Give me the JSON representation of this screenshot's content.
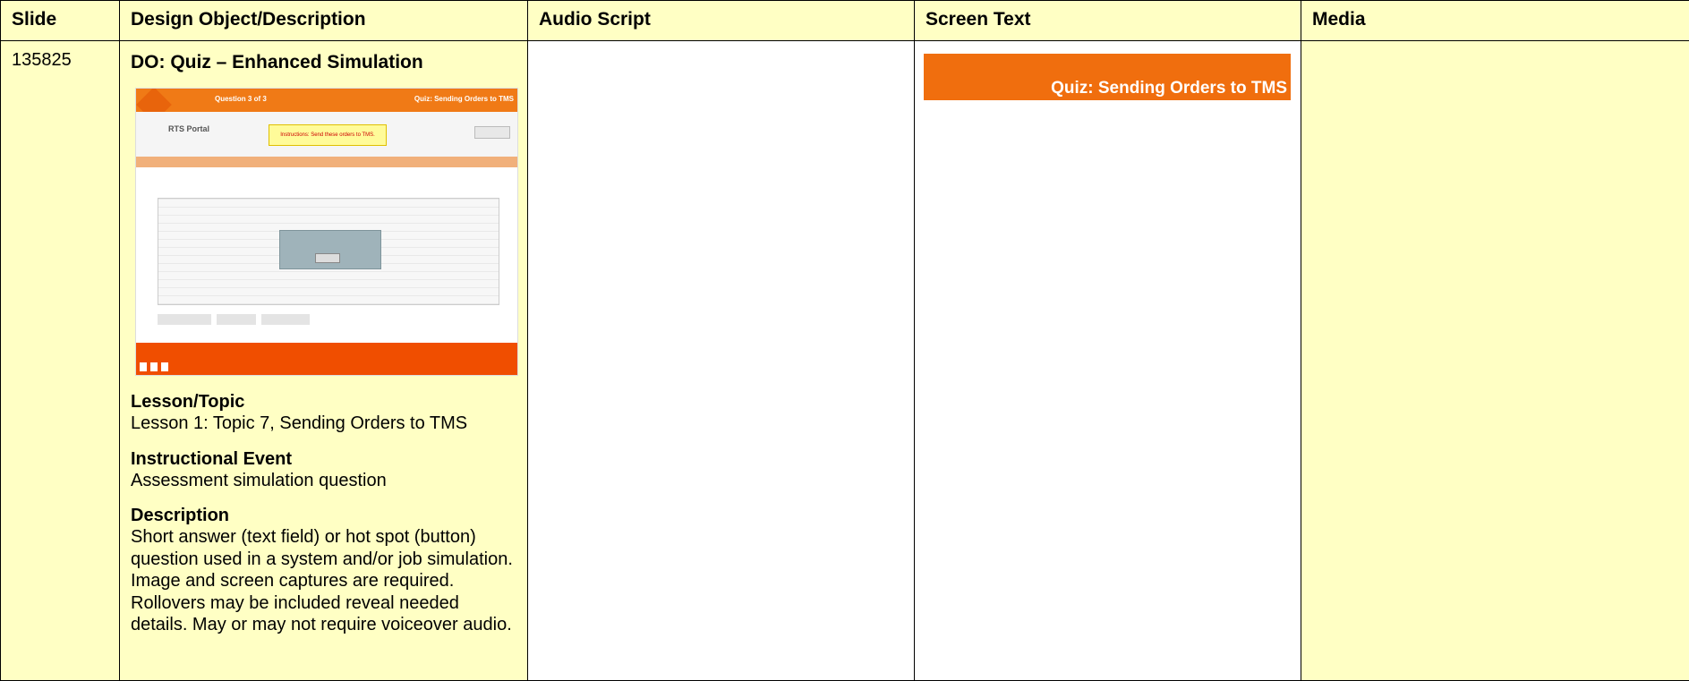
{
  "headers": {
    "slide": "Slide",
    "design": "Design Object/Description",
    "audio": "Audio Script",
    "screen": "Screen Text",
    "media": "Media"
  },
  "row": {
    "slide_id": "135825",
    "do_title": "DO: Quiz – Enhanced Simulation",
    "thumbnail": {
      "question": "Question 3 of 3",
      "title": "Quiz: Sending Orders to TMS",
      "portal": "RTS Portal",
      "instructions": "Instructions: Send these orders to TMS."
    },
    "lesson_head": "Lesson/Topic",
    "lesson_body": "Lesson 1: Topic 7, Sending Orders to TMS",
    "event_head": "Instructional Event",
    "event_body": "Assessment simulation question",
    "desc_head": "Description",
    "desc_body": "Short answer (text field) or hot spot (button) question used in a system and/or job simulation. Image and screen captures are required. Rollovers may be included reveal needed details. May or may not require voiceover audio.",
    "audio_script": "",
    "screen_text_banner": "Quiz: Sending Orders to TMS",
    "media": ""
  },
  "colors": {
    "cell_yellow": "#ffffc4",
    "banner_orange": "#f06e0e"
  }
}
